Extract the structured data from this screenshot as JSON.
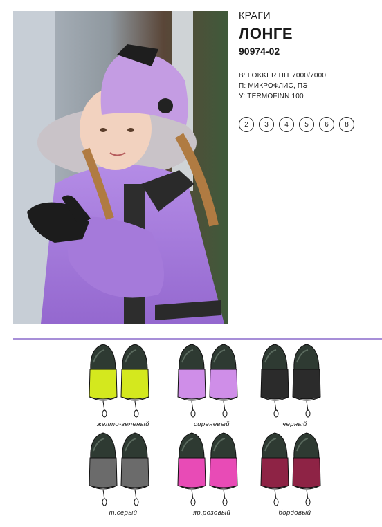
{
  "product": {
    "category": "КРАГИ",
    "name": "ЛОНГЕ",
    "article": "90974-02",
    "materials": [
      "В: LOKKER HIT  7000/7000",
      "П: МИКРОФЛИС, ПЭ",
      "У: TERMOFINN 100"
    ],
    "sizes": [
      "2",
      "3",
      "4",
      "5",
      "6",
      "8"
    ]
  },
  "photo": {
    "description": "girl in lilac winter jacket and knitted hat wearing black mittens"
  },
  "colors": [
    {
      "label": "желто-зеленый",
      "fill": "#d4e81e"
    },
    {
      "label": "сиреневый",
      "fill": "#cf8ee8"
    },
    {
      "label": "черный",
      "fill": "#2b2b2b"
    },
    {
      "label": "т.серый",
      "fill": "#6b6b6b"
    },
    {
      "label": "яр.розовый",
      "fill": "#e84bb6"
    },
    {
      "label": "бордовый",
      "fill": "#8e2345"
    }
  ],
  "accent": "#a78fd8"
}
